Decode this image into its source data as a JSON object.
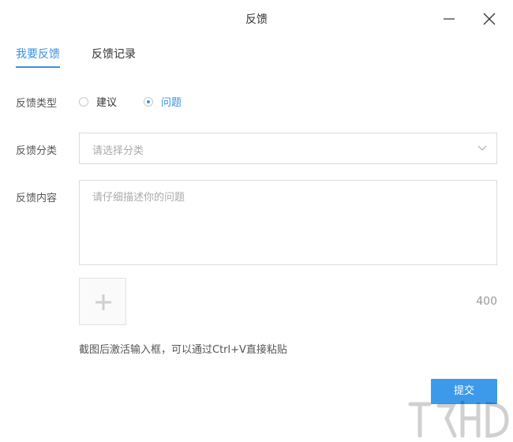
{
  "window": {
    "title": "反馈"
  },
  "tabs": [
    {
      "label": "我要反馈",
      "active": true
    },
    {
      "label": "反馈记录",
      "active": false
    }
  ],
  "form": {
    "type_label": "反馈类型",
    "type_options": [
      {
        "label": "建议",
        "checked": false
      },
      {
        "label": "问题",
        "checked": true
      }
    ],
    "category_label": "反馈分类",
    "category_placeholder": "请选择分类",
    "content_label": "反馈内容",
    "content_placeholder": "请仔细描述你的问题",
    "char_count": "400",
    "hint": "截图后激活输入框，可以通过Ctrl+V直接粘贴",
    "submit_label": "提交"
  },
  "colors": {
    "accent": "#3a93e0",
    "button": "#3d9aeb"
  },
  "icons": [
    "minimize-icon",
    "close-icon",
    "chevron-down-icon",
    "plus-icon"
  ]
}
